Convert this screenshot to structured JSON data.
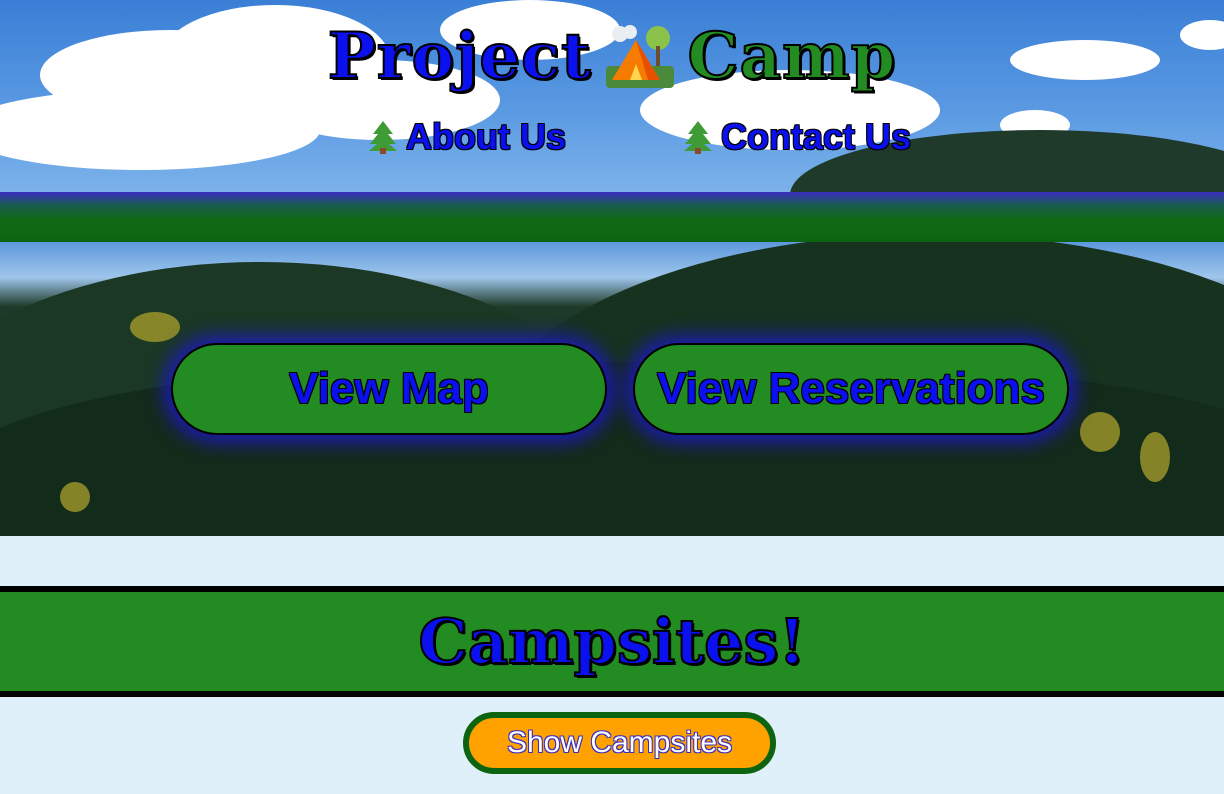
{
  "header": {
    "title_word_1": "Project",
    "title_icon": "tent-icon",
    "title_word_2": "Camp"
  },
  "nav": {
    "items": [
      {
        "label": "About Us",
        "icon": "tree-icon"
      },
      {
        "label": "Contact Us",
        "icon": "tree-icon"
      }
    ]
  },
  "hero": {
    "view_map_label": "View Map",
    "view_reservations_label": "View Reservations"
  },
  "campsites": {
    "heading": "Campsites!",
    "show_button_label": "Show Campsites"
  },
  "colors": {
    "title_blue": "#0a10ee",
    "forest_green": "#228b22",
    "band_dark_green": "#0d6410",
    "button_orange": "#ffa200",
    "page_background": "#e0f0fa"
  }
}
